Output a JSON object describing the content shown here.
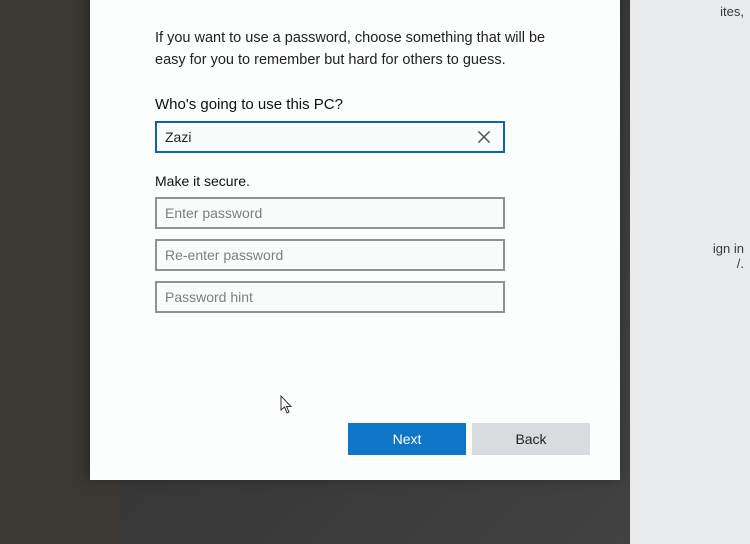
{
  "intro": "If you want to use a password, choose something that will be easy for you to remember but hard for others to guess.",
  "section1_label": "Who's going to use this PC?",
  "username_value": "Zazi",
  "section2_label": "Make it secure.",
  "password_placeholder": "Enter password",
  "password_confirm_placeholder": "Re-enter password",
  "password_hint_placeholder": "Password hint",
  "buttons": {
    "next": "Next",
    "back": "Back"
  },
  "background_fragments": {
    "top": "ites,",
    "mid_line1": "ign in",
    "mid_line2": "/."
  },
  "colors": {
    "accent": "#0f75c6"
  }
}
